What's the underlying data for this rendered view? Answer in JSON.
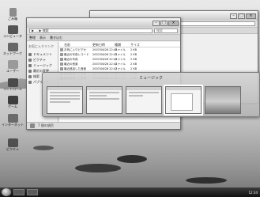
{
  "desktop": {
    "icons": [
      {
        "name": "recycle-bin-icon",
        "label": "ごみ箱"
      },
      {
        "name": "computer-icon",
        "label": "コンピュータ"
      },
      {
        "name": "network-icon",
        "label": "ネットワーク"
      },
      {
        "name": "user-folder-icon",
        "label": "ユーザー"
      },
      {
        "name": "control-panel-icon",
        "label": "コントロール"
      },
      {
        "name": "media-icon",
        "label": "ゲーム"
      },
      {
        "name": "ie-icon",
        "label": "インターネット"
      },
      {
        "name": "photo-icon",
        "label": "ピクチャ"
      }
    ]
  },
  "back_window": {
    "address": "▶ ... ▶ ミュージック",
    "toolbar": [
      "整理",
      "表示",
      "スライドショー"
    ]
  },
  "explorer": {
    "address": "▶ ... ▶ 検索",
    "search_placeholder": "検索",
    "toolbar": [
      "整理",
      "表示",
      "書き込む"
    ],
    "sidebar_header": "お気に入りリンク",
    "sidebar_items": [
      "ドキュメント",
      "ピクチャ",
      "ミュージック",
      "最近の変更",
      "検索",
      "パブリック"
    ],
    "columns": [
      "名前",
      "更新日時",
      "種類",
      "サイズ",
      ""
    ],
    "rows": [
      [
        "お気に入りビデオ",
        "2007/06/26 22:46",
        "ファイル",
        "2 KB"
      ],
      [
        "最近の写真レコード",
        "2007/06/26 22:45",
        "ファイル",
        "2 KB"
      ],
      [
        "最近の写真",
        "2007/06/26 22:44",
        "ファイル",
        "2 KB"
      ],
      [
        "最近の音楽",
        "2007/06/26 22:44",
        "ファイル",
        "2 KB"
      ],
      [
        "最近追加した音楽",
        "2007/06/26 22:43",
        "ファイル",
        "2 KB"
      ],
      [
        "最近使用した写真",
        "2007/06/26 22:43",
        "ファイル",
        "2 KB"
      ],
      [
        "最近評価した写真",
        "2007/06/26 22:42",
        "ファイル",
        "2 KB"
      ]
    ],
    "status_text": "7 個の項目"
  },
  "switcher": {
    "title": "ミュージック",
    "selected_index": 3
  },
  "taskbar": {
    "tray_text": "12:34"
  }
}
